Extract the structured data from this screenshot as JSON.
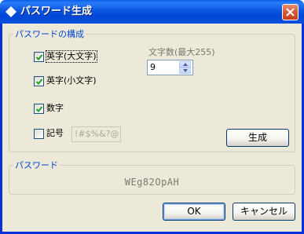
{
  "window": {
    "title": "パスワード生成",
    "close_label": "×"
  },
  "composition": {
    "legend": "パスワードの構成",
    "options": [
      {
        "label": "英字(大文字)",
        "checked": true
      },
      {
        "label": "英字(小文字)",
        "checked": true
      },
      {
        "label": "数字",
        "checked": true
      },
      {
        "label": "記号",
        "checked": false
      }
    ],
    "symbols_value": "!#$%&?@",
    "length_label": "文字数(最大255)",
    "length_value": "9",
    "generate_label": "生成"
  },
  "result": {
    "legend": "パスワード",
    "password": "WEg82OpAH"
  },
  "footer": {
    "ok_label": "OK",
    "cancel_label": "キャンセル"
  },
  "colors": {
    "titlebar": "#0054e3",
    "dialog_bg": "#ece9d8",
    "group_legend": "#0046d5",
    "checkmark": "#21a121"
  }
}
